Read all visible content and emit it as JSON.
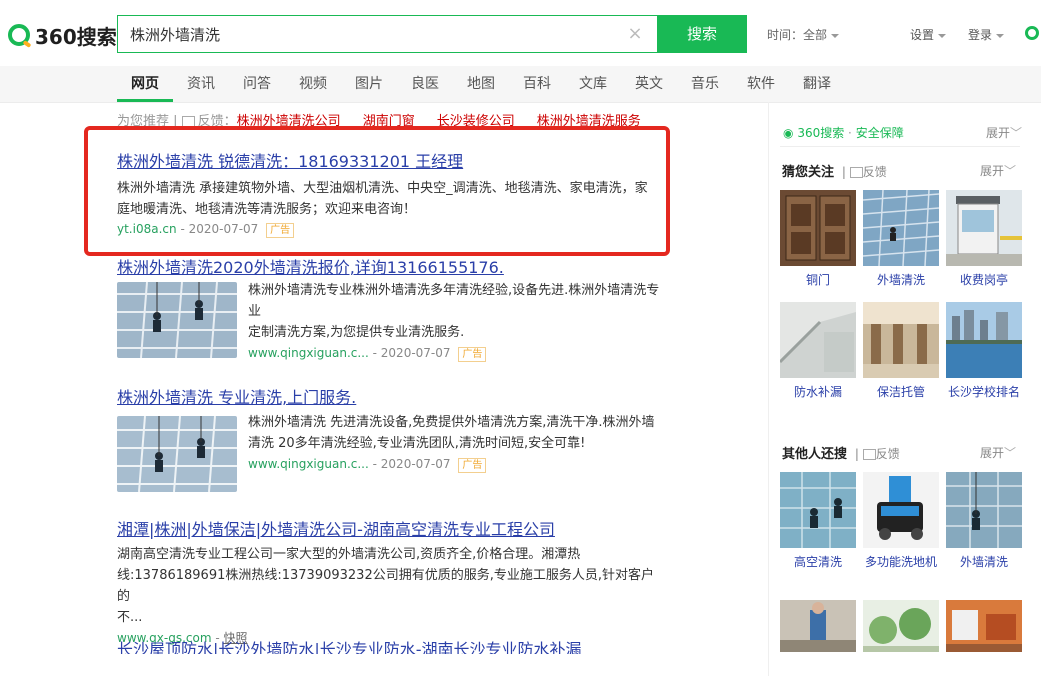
{
  "header": {
    "logo_text": "360搜索",
    "query": "株洲外墙清洗",
    "search_button": "搜索",
    "time_filter": "时间：全部",
    "settings": "设置",
    "login": "登录"
  },
  "tabs": [
    "网页",
    "资讯",
    "问答",
    "视频",
    "图片",
    "良医",
    "地图",
    "百科",
    "文库",
    "英文",
    "音乐",
    "软件",
    "翻译"
  ],
  "recommend": {
    "prefix": "为您推荐 | ",
    "feedback": "反馈：",
    "links": [
      "株洲外墙清洗公司",
      "湖南门窗",
      "长沙装修公司",
      "株洲外墙清洗服务"
    ]
  },
  "results": [
    {
      "title": "株洲外墙清洗 锐德清洗：18169331201 王经理",
      "snippet_line1": "株洲外墙清洗 承接建筑物外墙、大型油烟机清洗、中央空_调清洗、地毯清洗、家电清洗，家",
      "snippet_line2": "庭地暖清洗、地毯清洗等清洗服务；欢迎来电咨询！",
      "url": "yt.i08a.cn",
      "date": "- 2020-07-07",
      "ad": "广告"
    },
    {
      "title": "株洲外墙清洗2020外墙清洗报价,详询13166155176.",
      "snippet_line1": "株洲外墙清洗专业株洲外墙清洗多年清洗经验,设备先进.株洲外墙清洗专业",
      "snippet_line2": "定制清洗方案,为您提供专业清洗服务.",
      "url": "www.qingxiguan.c...",
      "date": "- 2020-07-07",
      "ad": "广告"
    },
    {
      "title": "株洲外墙清洗 专业清洗,上门服务.",
      "snippet_line1": "株洲外墙清洗 先进清洗设备,免费提供外墙清洗方案,清洗干净.株洲外墙",
      "snippet_line2": "清洗 20多年清洗经验,专业清洗团队,清洗时间短,安全可靠!",
      "url": "www.qingxiguan.c...",
      "date": "- 2020-07-07",
      "ad": "广告"
    },
    {
      "title": "湘潭|株洲|外墙保洁|外墙清洗公司-湖南高空清洗专业工程公司",
      "snippet_line1": "湖南高空清洗专业工程公司一家大型的外墙清洗公司,资质齐全,价格合理。湘潭热",
      "snippet_line2": "线:13786189691株洲热线:13739093232公司拥有优质的服务,专业施工服务人员,针对客户的",
      "snippet_line3": "不...",
      "url": "www.qx-gs.com",
      "cache": "快照"
    },
    {
      "title": "长沙屋顶防水|长沙外墙防水|长沙专业防水-湖南长沙专业防水补漏"
    }
  ],
  "sidebar": {
    "safe_brand": "360搜索",
    "safe_text": "安全保障",
    "expand": "展开",
    "sections": [
      {
        "title": "猜您关注",
        "feedback": "反馈",
        "expand": "展开",
        "tiles": [
          "铜门",
          "外墙清洗",
          "收费岗亭",
          "防水补漏",
          "保洁托管",
          "长沙学校排名"
        ]
      },
      {
        "title": "其他人还搜",
        "feedback": "反馈",
        "expand": "展开",
        "tiles": [
          "高空清洗",
          "多功能洗地机",
          "外墙清洗"
        ]
      }
    ]
  },
  "colors": {
    "brand_green": "#19b955",
    "link_blue": "#2a3fa8",
    "highlight_red": "#cc0000",
    "annotation_red": "#e4281f"
  }
}
